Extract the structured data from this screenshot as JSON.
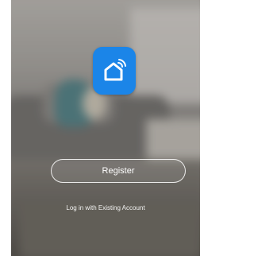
{
  "app": {
    "icon": "smart-home-icon",
    "accent_color": "#1b85e8"
  },
  "actions": {
    "register_label": "Register",
    "login_label": "Log in with Existing Account"
  }
}
